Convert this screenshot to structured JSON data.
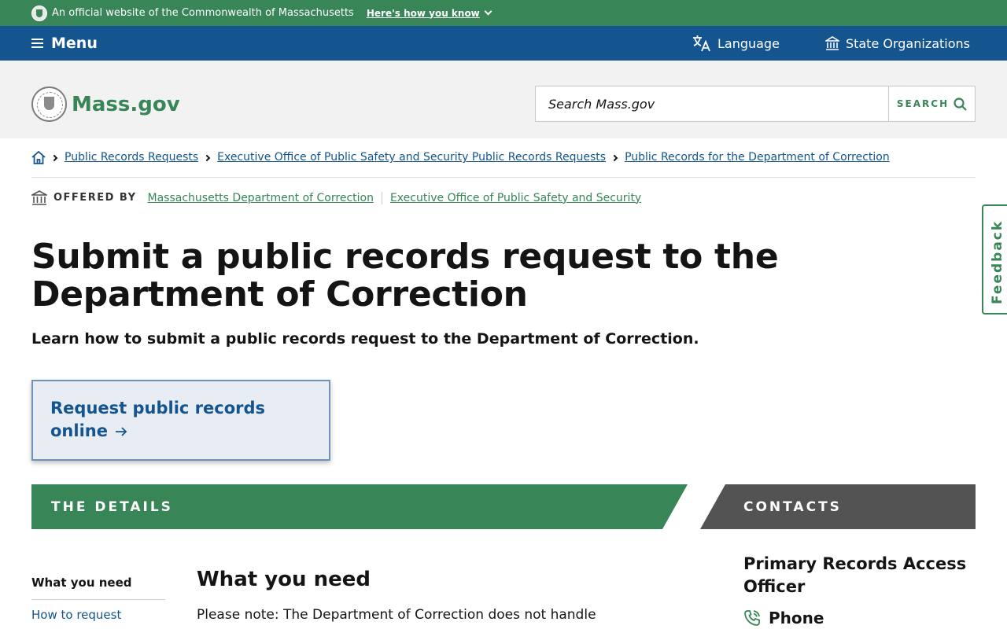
{
  "official_banner": {
    "text": "An official website of the Commonwealth of Massachusetts",
    "how_link": "Here's how you know"
  },
  "nav": {
    "menu_label": "Menu",
    "language_label": "Language",
    "state_orgs_label": "State Organizations"
  },
  "header": {
    "logo_text": "Mass.gov",
    "search_placeholder": "Search Mass.gov",
    "search_button": "SEARCH"
  },
  "breadcrumbs": [
    "Public Records Requests",
    "Executive Office of Public Safety and Security Public Records Requests",
    "Public Records for the Department of Correction"
  ],
  "offered_by": {
    "label": "OFFERED BY",
    "orgs": [
      "Massachusetts Department of Correction",
      "Executive Office of Public Safety and Security"
    ]
  },
  "page": {
    "title": "Submit a public records request to the Department of Correction",
    "lead": "Learn how to submit a public records request to the Department of Correction.",
    "callout_label": "Request public records online"
  },
  "sections": {
    "details_label": "THE DETAILS",
    "contacts_label": "CONTACTS"
  },
  "jump_nav": {
    "current": "What you need",
    "next": "How to request"
  },
  "content": {
    "heading": "What you need",
    "body": "Please note: The Department of Correction does not handle"
  },
  "contact": {
    "name": "Primary Records Access Officer",
    "phone_label": "Phone"
  },
  "feedback_label": "Feedback",
  "colors": {
    "green": "#388557",
    "blue": "#14558f",
    "gray_bar": "#535353"
  }
}
